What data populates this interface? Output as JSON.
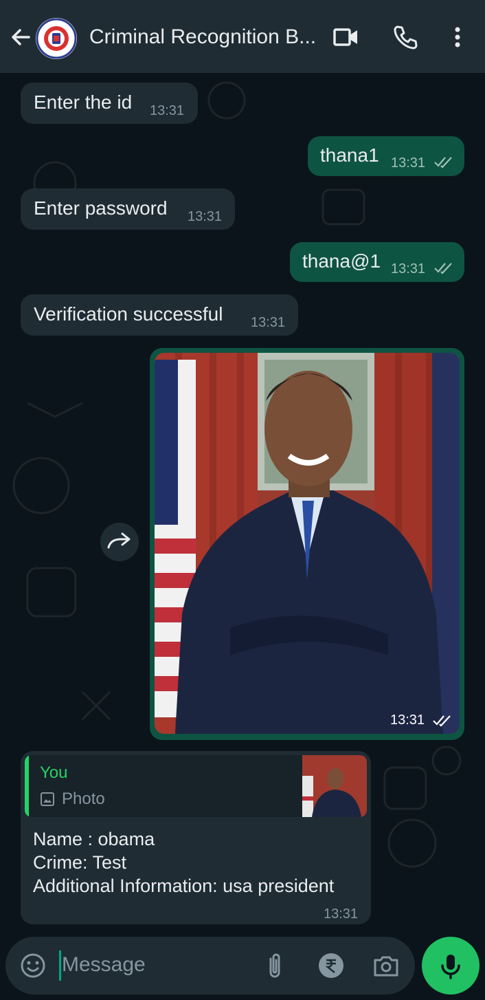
{
  "header": {
    "title": "Criminal Recognition B...",
    "back_icon": "arrow-left-icon",
    "video_icon": "video-call-icon",
    "call_icon": "phone-icon",
    "more_icon": "more-vertical-icon"
  },
  "messages": [
    {
      "dir": "in",
      "text": "Enter the id",
      "time": "13:31"
    },
    {
      "dir": "out",
      "text": "thana1",
      "time": "13:31",
      "status": "read"
    },
    {
      "dir": "in",
      "text": "Enter password",
      "time": "13:31"
    },
    {
      "dir": "out",
      "text": "thana@1",
      "time": "13:31",
      "status": "read"
    },
    {
      "dir": "in",
      "text": "Verification successful",
      "time": "13:31"
    }
  ],
  "photo_message": {
    "time": "13:31",
    "status": "read",
    "forward_icon": "forward-icon"
  },
  "reply_message": {
    "quote_name": "You",
    "quote_type": "Photo",
    "lines": [
      "Name : obama",
      "Crime: Test",
      "Additional Information: usa president"
    ],
    "time": "13:31"
  },
  "input": {
    "placeholder": "Message",
    "emoji_icon": "emoji-icon",
    "attach_icon": "paperclip-icon",
    "payment_icon": "rupee-icon",
    "camera_icon": "camera-icon",
    "mic_icon": "microphone-icon"
  },
  "colors": {
    "background": "#0b141a",
    "bar": "#1f2c34",
    "incoming": "#1f2c34",
    "outgoing": "#0e5442",
    "accent": "#25d366"
  }
}
